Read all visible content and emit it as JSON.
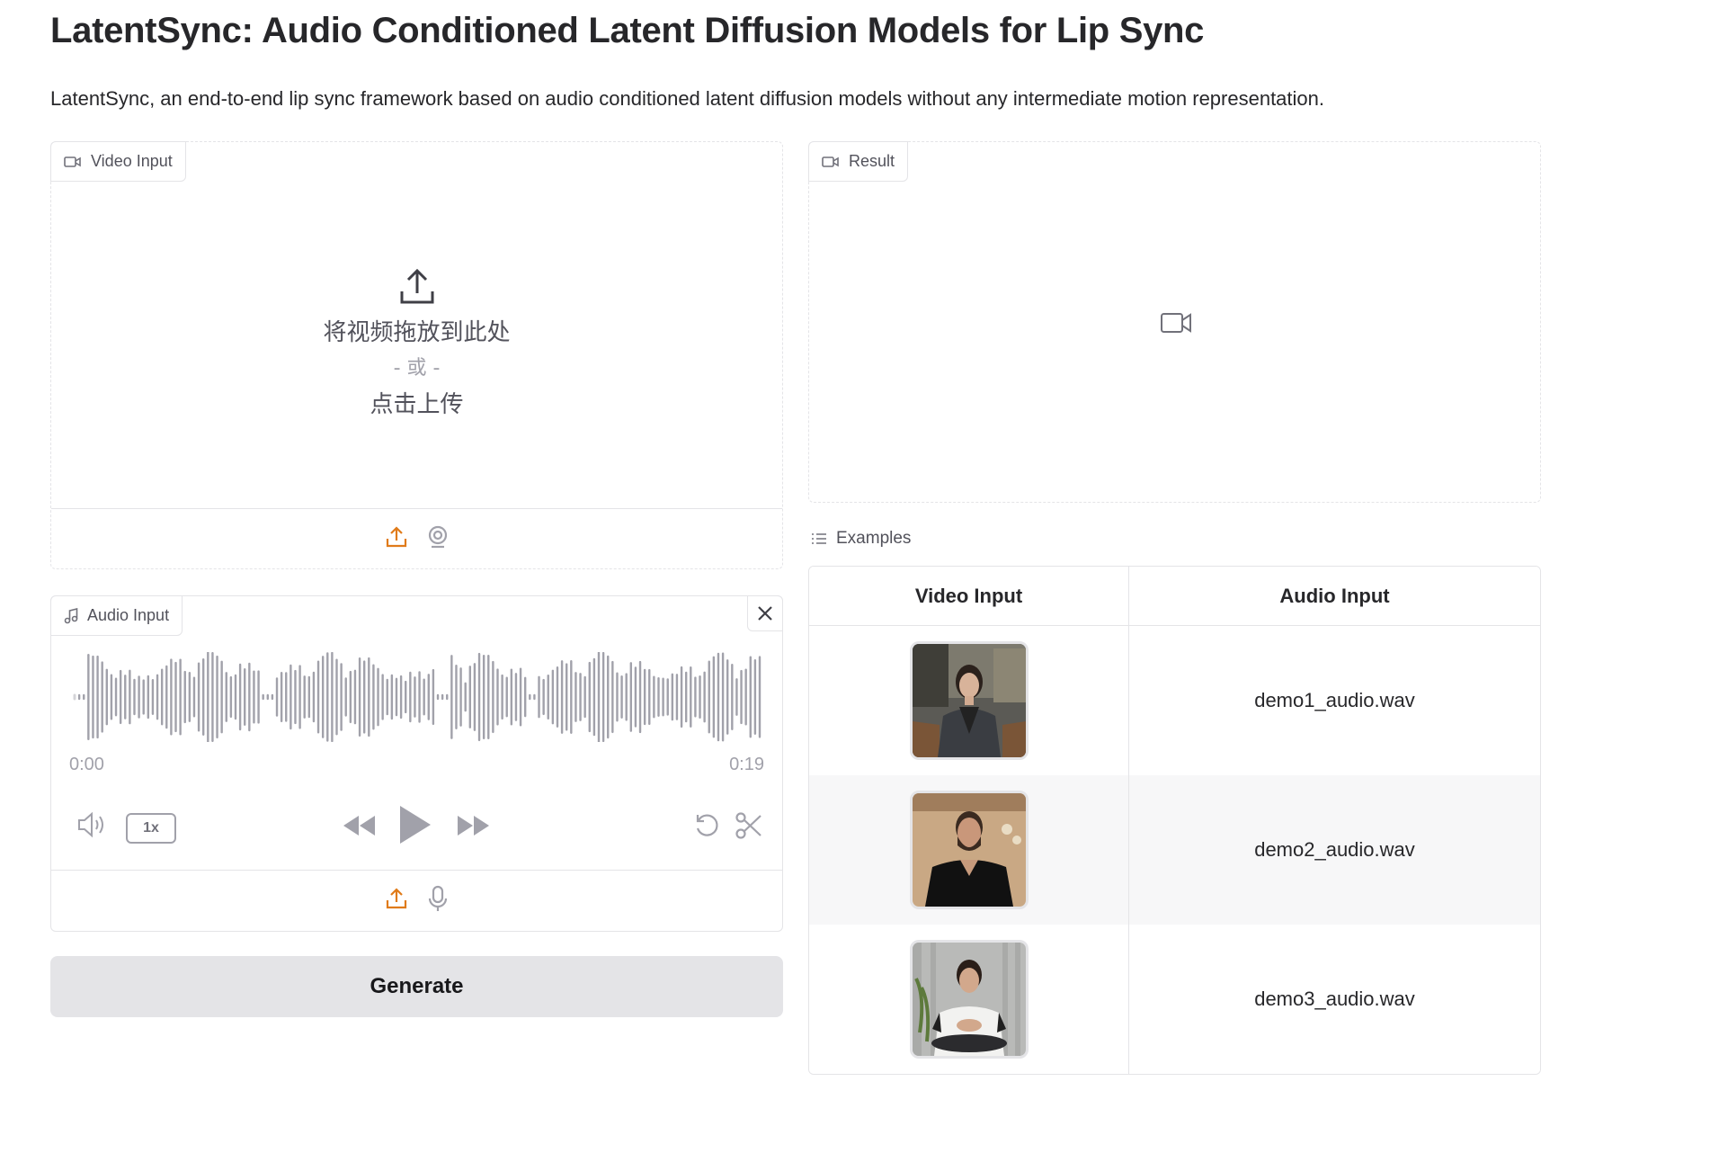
{
  "header": {
    "title": "LatentSync: Audio Conditioned Latent Diffusion Models for Lip Sync",
    "description": "LatentSync, an end-to-end lip sync framework based on audio conditioned latent diffusion models without any intermediate motion representation."
  },
  "video_input": {
    "label": "Video Input",
    "drop_text": "将视频拖放到此处",
    "or_text": "- 或 -",
    "click_text": "点击上传",
    "icons": [
      "upload-icon",
      "webcam-icon"
    ],
    "accent_color": "#e07b1a"
  },
  "audio_input": {
    "label": "Audio Input",
    "time_start": "0:00",
    "time_end": "0:19",
    "playback_rate": "1x",
    "icons": [
      "volume-icon",
      "rewind-icon",
      "play-icon",
      "fast-forward-icon",
      "undo-icon",
      "scissors-icon",
      "upload-icon",
      "microphone-icon",
      "close-icon"
    ]
  },
  "generate_button": {
    "label": "Generate"
  },
  "result": {
    "label": "Result",
    "icon": "video-camera-icon"
  },
  "examples": {
    "label": "Examples",
    "columns": [
      "Video Input",
      "Audio Input"
    ],
    "rows": [
      {
        "video_thumbnail": "woman-in-grey-coat-thumbnail",
        "audio": "demo1_audio.wav"
      },
      {
        "video_thumbnail": "bearded-man-in-black-sweater-thumbnail",
        "audio": "demo2_audio.wav"
      },
      {
        "video_thumbnail": "man-in-white-tshirt-thumbnail",
        "audio": "demo3_audio.wav"
      }
    ]
  }
}
